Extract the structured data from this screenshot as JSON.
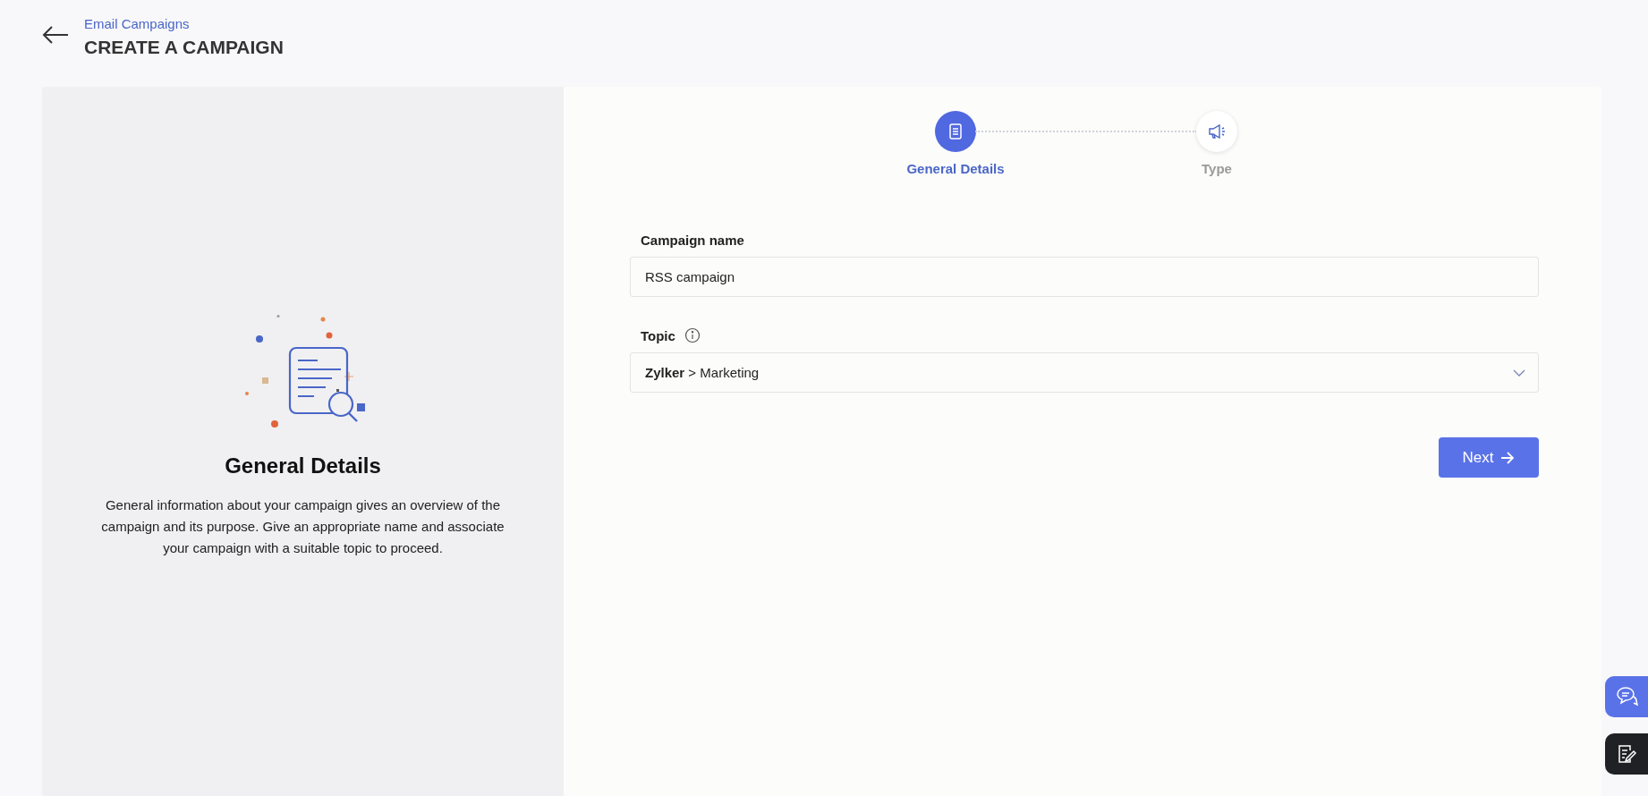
{
  "header": {
    "breadcrumb": "Email Campaigns",
    "title": "CREATE A CAMPAIGN"
  },
  "info_panel": {
    "title": "General Details",
    "description": "General information about your campaign gives an overview of the campaign and its purpose. Give an appropriate name and associate your campaign with a suitable topic to proceed."
  },
  "steps": [
    {
      "label": "General Details",
      "kind": "details",
      "selected": true
    },
    {
      "label": "Type",
      "kind": "type",
      "selected": false
    }
  ],
  "form": {
    "fields": [
      {
        "label": "Campaign name",
        "kind": "text",
        "value": "RSS campaign"
      },
      {
        "label": "Topic",
        "kind": "select",
        "info": true,
        "value": "**Zylker** > Marketing"
      }
    ],
    "next_button": "Next"
  }
}
